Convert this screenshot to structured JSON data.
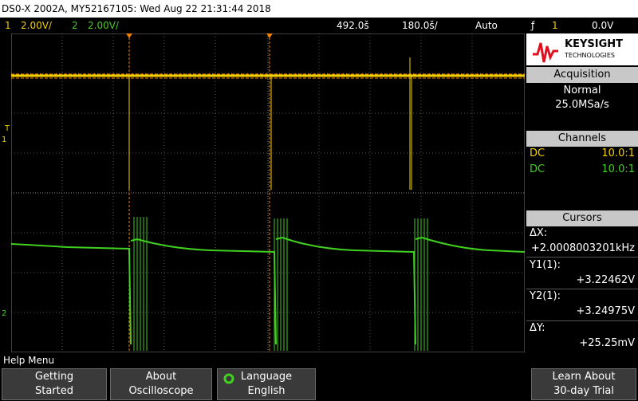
{
  "title_bar": "DS0-X 2002A, MY52167105: Wed Aug 22 21:31:44 2018",
  "status": {
    "ch1_num": "1",
    "ch1_scale": "2.00V/",
    "ch2_num": "2",
    "ch2_scale": "2.00V/",
    "time_delay": "492.0š",
    "time_scale": "180.0š/",
    "mode": "Auto",
    "trigger_icon": "ƒ",
    "trigger_channel": "1",
    "trigger_level": "0.0V"
  },
  "screen": {
    "ch1_marker": "1",
    "ch2_marker": "2",
    "trig_marker": "T"
  },
  "panel": {
    "brand": "KEYSIGHT",
    "brand_sub": "TECHNOLOGIES",
    "acquisition": {
      "title": "Acquisition",
      "mode": "Normal",
      "rate": "25.0MSa/s"
    },
    "channels": {
      "title": "Channels",
      "rows": [
        {
          "coupling": "DC",
          "probe": "10.0:1"
        },
        {
          "coupling": "DC",
          "probe": "10.0:1"
        }
      ]
    },
    "cursors": {
      "title": "Cursors",
      "dx_label": "ΔX:",
      "dx_value": "+2.0008003201kHz",
      "y1_label": "Y1(1):",
      "y1_value": "+3.22462V",
      "y2_label": "Y2(1):",
      "y2_value": "+3.24975V",
      "dy_label": "ΔY:",
      "dy_value": "+25.25mV"
    }
  },
  "help_menu": "Help Menu",
  "softkeys": {
    "getting_started": [
      "Getting",
      "Started"
    ],
    "about": [
      "About",
      "Oscilloscope"
    ],
    "language": [
      "Language",
      "English"
    ],
    "learn": [
      "Learn About",
      "30-day Trial"
    ]
  },
  "colors": {
    "ch1": "#f0d000",
    "ch2": "#40d020",
    "panel_title": "#c8c8c8",
    "cursor": "#f08000"
  }
}
